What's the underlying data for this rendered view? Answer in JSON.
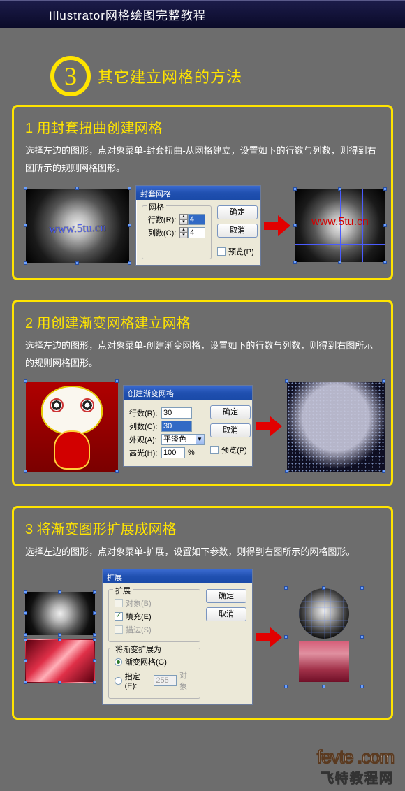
{
  "titlebar": {
    "text": "Illustrator网格绘图完整教程"
  },
  "section": {
    "number": "3",
    "title": "其它建立网格的方法"
  },
  "card1": {
    "title": "1 用封套扭曲创建网格",
    "desc": "选择左边的图形，点对象菜单-封套扭曲-从网格建立，设置如下的行数与列数，则得到右图所示的规则网格图形。",
    "watermark_left": "www.5tu.cn",
    "watermark_right": "www.5tu.cn",
    "dialog": {
      "title": "封套网格",
      "legend": "网格",
      "rows_label": "行数(R):",
      "rows_value": "4",
      "cols_label": "列数(C):",
      "cols_value": "4",
      "ok": "确定",
      "cancel": "取消",
      "preview": "预览(P)"
    }
  },
  "card2": {
    "title": "2 用创建渐变网格建立网格",
    "desc": "选择左边的图形，点对象菜单-创建渐变网格，设置如下的行数与列数，则得到右图所示的规则网格图形。",
    "dialog": {
      "title": "创建渐变网格",
      "rows_label": "行数(R):",
      "rows_value": "30",
      "cols_label": "列数(C):",
      "cols_value": "30",
      "appearance_label": "外观(A):",
      "appearance_value": "平淡色",
      "highlight_label": "高光(H):",
      "highlight_value": "100",
      "pct": "%",
      "ok": "确定",
      "cancel": "取消",
      "preview": "预览(P)"
    }
  },
  "card3": {
    "title": "3 将渐变图形扩展成网格",
    "desc": "选择左边的图形，点对象菜单-扩展，设置如下参数，则得到右图所示的网格图形。",
    "dialog": {
      "title": "扩展",
      "legend1": "扩展",
      "opt_object": "对象(B)",
      "opt_fill": "填充(E)",
      "opt_stroke": "描边(S)",
      "legend2": "将渐变扩展为",
      "opt_mesh": "渐变网格(G)",
      "opt_specify": "指定(E):",
      "specify_value": "255",
      "specify_unit": "对象",
      "ok": "确定",
      "cancel": "取消"
    }
  },
  "footer": {
    "brand": "fevte",
    "dot": ".",
    "com": "com",
    "cn": "飞特教程网"
  }
}
